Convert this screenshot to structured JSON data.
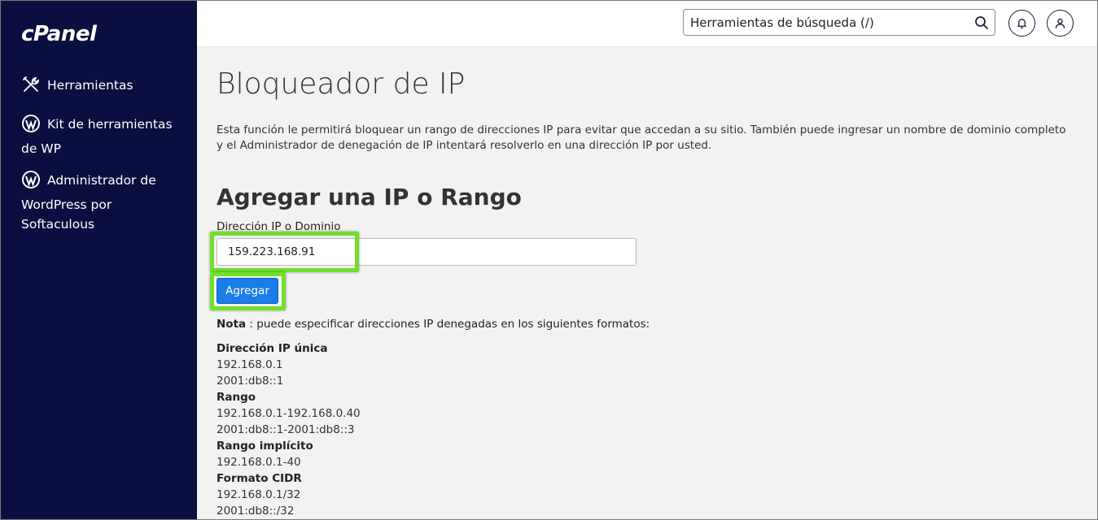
{
  "sidebar": {
    "logo": "cPanel",
    "items": [
      {
        "label": "Herramientas",
        "icon": "tools-icon"
      },
      {
        "label": "Kit de herramientas de WP",
        "icon": "wordpress-icon"
      },
      {
        "label_line1": "Administrador de",
        "label_rest": "WordPress por Softaculous",
        "icon": "wordpress-icon"
      }
    ]
  },
  "topbar": {
    "search_placeholder": "Herramientas de búsqueda (/)",
    "icons": [
      "search-icon",
      "bell-icon",
      "user-icon"
    ]
  },
  "main": {
    "title": "Bloqueador de IP",
    "description": "Esta función le permitirá bloquear un rango de direcciones IP para evitar que accedan a su sitio. También puede ingresar un nombre de dominio completo y el Administrador de denegación de IP intentará resolverlo en una dirección IP por usted.",
    "section_title": "Agregar una IP o Rango",
    "field_label": "Dirección IP o Dominio",
    "field_value": "159.223.168.91",
    "add_button": "Agregar",
    "note_label": "Nota",
    "note_text": " : puede especificar direcciones IP denegadas en los siguientes formatos:",
    "formats": [
      {
        "heading": "Dirección IP única",
        "examples": [
          "192.168.0.1",
          "2001:db8::1"
        ]
      },
      {
        "heading": "Rango",
        "examples": [
          "192.168.0.1-192.168.0.40",
          "2001:db8::1-2001:db8::3"
        ]
      },
      {
        "heading": "Rango implícito",
        "examples": [
          "192.168.0.1-40"
        ]
      },
      {
        "heading": "Formato CIDR",
        "examples": [
          "192.168.0.1/32",
          "2001:db8::/32"
        ]
      }
    ]
  },
  "colors": {
    "sidebar_bg": "#0b0f3f",
    "button_blue": "#1a7de8",
    "highlight_green": "#6fe02b"
  }
}
